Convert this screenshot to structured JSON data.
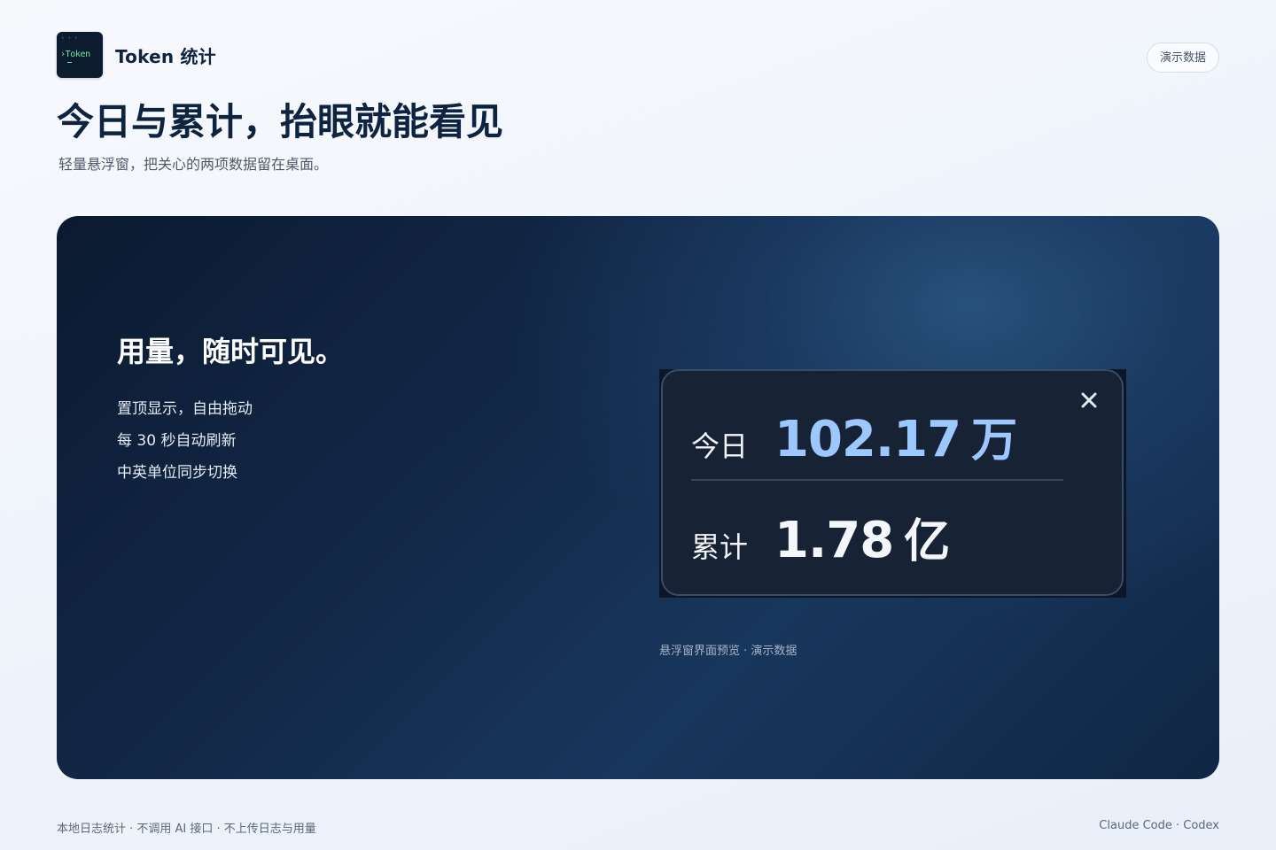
{
  "header": {
    "logo_text": "›Token",
    "brand_name": "Token 统计",
    "demo_badge": "演示数据"
  },
  "hero": {
    "title": "今日与累计，抬眼就能看见",
    "subtitle": "轻量悬浮窗，把关心的两项数据留在桌面。"
  },
  "panel": {
    "title": "用量，随时可见。",
    "features": [
      "置顶显示，自由拖动",
      "每 30 秒自动刷新",
      "中英单位同步切换"
    ],
    "widget": {
      "today": {
        "label": "今日",
        "value": "102.17",
        "unit": "万"
      },
      "total": {
        "label": "累计",
        "value": "1.78",
        "unit": "亿"
      },
      "close_icon": "close-icon"
    },
    "caption": "悬浮窗界面预览 · 演示数据"
  },
  "footer": {
    "left": "本地日志统计 · 不调用 AI 接口 · 不上传日志与用量",
    "right": "Claude Code · Codex"
  },
  "colors": {
    "accent_today": "#9cc7ff",
    "panel_dark": "#13294a",
    "logo_green": "#6ee7a6"
  }
}
